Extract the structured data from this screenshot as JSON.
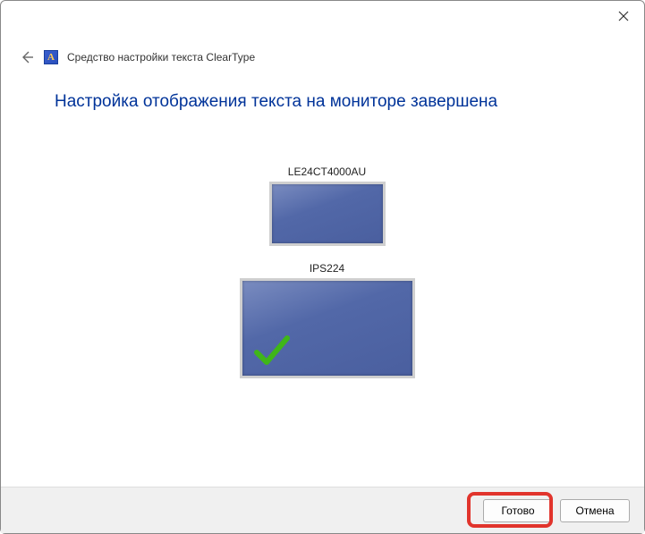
{
  "window": {
    "title": "Средство настройки текста ClearType",
    "icon_letter": "A"
  },
  "heading": "Настройка отображения текста на мониторе завершена",
  "monitors": [
    {
      "name": "LE24CT4000AU",
      "checked": false
    },
    {
      "name": "IPS224",
      "checked": true
    }
  ],
  "buttons": {
    "done": "Готово",
    "cancel": "Отмена"
  }
}
